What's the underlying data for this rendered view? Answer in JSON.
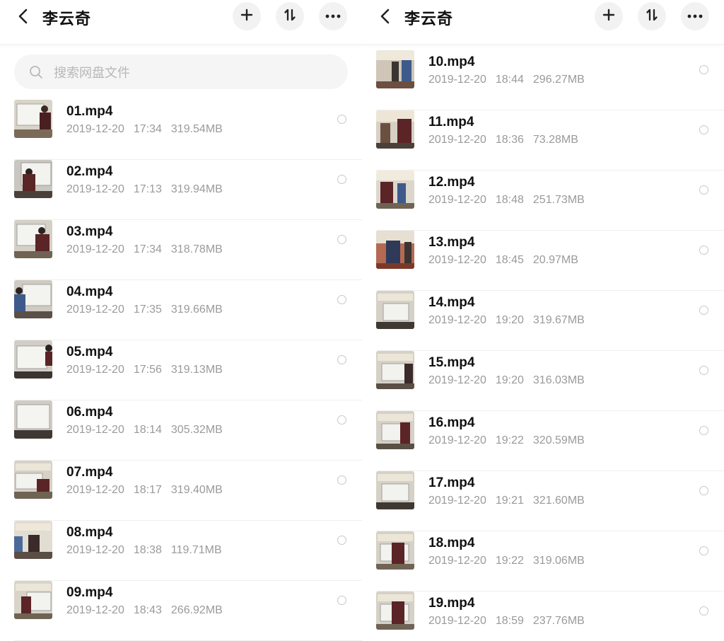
{
  "colors": {
    "accent_button_bg": "#f2f2f2",
    "meta_text": "#9a9a9a",
    "divider": "#efefef"
  },
  "left": {
    "header": {
      "title": "李云奇",
      "back_icon": "chevron-left-icon",
      "add_icon": "plus-icon",
      "sort_icon": "sort-icon",
      "more_icon": "more-dots-icon"
    },
    "search": {
      "placeholder": "搜索网盘文件",
      "value": "",
      "icon": "search-icon"
    },
    "files": [
      {
        "name": "01.mp4",
        "date": "2019-12-20",
        "time": "17:34",
        "size": "319.54MB"
      },
      {
        "name": "02.mp4",
        "date": "2019-12-20",
        "time": "17:13",
        "size": "319.94MB"
      },
      {
        "name": "03.mp4",
        "date": "2019-12-20",
        "time": "17:34",
        "size": "318.78MB"
      },
      {
        "name": "04.mp4",
        "date": "2019-12-20",
        "time": "17:35",
        "size": "319.66MB"
      },
      {
        "name": "05.mp4",
        "date": "2019-12-20",
        "time": "17:56",
        "size": "319.13MB"
      },
      {
        "name": "06.mp4",
        "date": "2019-12-20",
        "time": "18:14",
        "size": "305.32MB"
      },
      {
        "name": "07.mp4",
        "date": "2019-12-20",
        "time": "18:17",
        "size": "319.40MB"
      },
      {
        "name": "08.mp4",
        "date": "2019-12-20",
        "time": "18:38",
        "size": "119.71MB"
      },
      {
        "name": "09.mp4",
        "date": "2019-12-20",
        "time": "18:43",
        "size": "266.92MB"
      }
    ]
  },
  "right": {
    "header": {
      "title": "李云奇",
      "back_icon": "chevron-left-icon",
      "add_icon": "plus-icon",
      "sort_icon": "sort-icon",
      "more_icon": "more-dots-icon"
    },
    "files": [
      {
        "name": "10.mp4",
        "date": "2019-12-20",
        "time": "18:44",
        "size": "296.27MB"
      },
      {
        "name": "11.mp4",
        "date": "2019-12-20",
        "time": "18:36",
        "size": "73.28MB"
      },
      {
        "name": "12.mp4",
        "date": "2019-12-20",
        "time": "18:48",
        "size": "251.73MB"
      },
      {
        "name": "13.mp4",
        "date": "2019-12-20",
        "time": "18:45",
        "size": "20.97MB"
      },
      {
        "name": "14.mp4",
        "date": "2019-12-20",
        "time": "19:20",
        "size": "319.67MB"
      },
      {
        "name": "15.mp4",
        "date": "2019-12-20",
        "time": "19:20",
        "size": "316.03MB"
      },
      {
        "name": "16.mp4",
        "date": "2019-12-20",
        "time": "19:22",
        "size": "320.59MB"
      },
      {
        "name": "17.mp4",
        "date": "2019-12-20",
        "time": "19:21",
        "size": "321.60MB"
      },
      {
        "name": "18.mp4",
        "date": "2019-12-20",
        "time": "19:22",
        "size": "319.06MB"
      },
      {
        "name": "19.mp4",
        "date": "2019-12-20",
        "time": "18:59",
        "size": "237.76MB"
      }
    ]
  }
}
